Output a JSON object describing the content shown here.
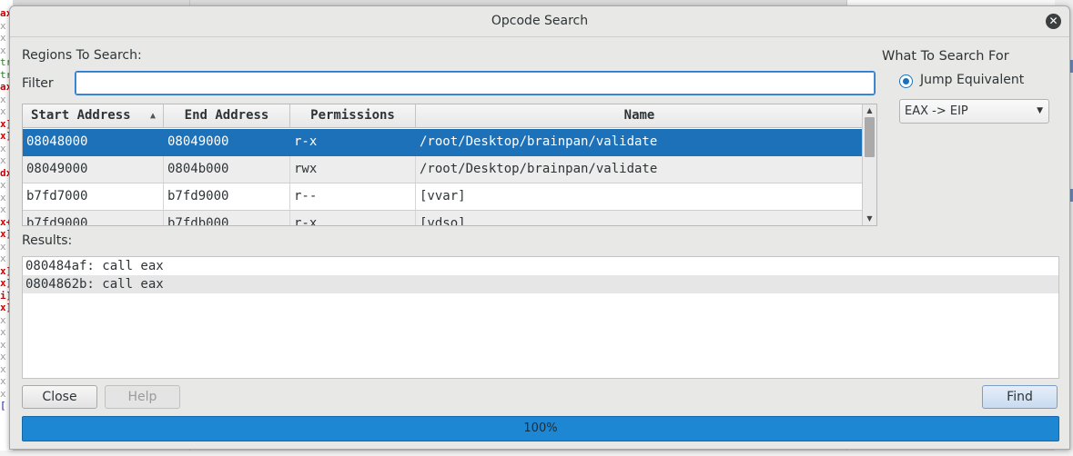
{
  "dialog": {
    "title": "Opcode Search",
    "regions_label": "Regions To Search:",
    "filter_label": "Filter",
    "filter_value": "",
    "what_to_search_label": "What To Search For",
    "search_type": "Jump Equivalent",
    "combo_value": "EAX -> EIP",
    "results_label": "Results:",
    "close_button": "Close",
    "help_button": "Help",
    "find_button": "Find",
    "progress_text": "100%",
    "progress_value": 1.0
  },
  "regions": {
    "columns": [
      "Start Address",
      "End Address",
      "Permissions",
      "Name"
    ],
    "rows": [
      {
        "start": "08048000",
        "end": "08049000",
        "perm": "r-x",
        "name": "/root/Desktop/brainpan/validate"
      },
      {
        "start": "08049000",
        "end": "0804b000",
        "perm": "rwx",
        "name": "/root/Desktop/brainpan/validate"
      },
      {
        "start": "b7fd7000",
        "end": "b7fd9000",
        "perm": "r--",
        "name": "[vvar]"
      },
      {
        "start": "b7fd9000",
        "end": "b7fdb000",
        "perm": "r-x",
        "name": "[vdso]"
      }
    ]
  },
  "results": [
    "080484af: call eax",
    "0804862b: call eax"
  ],
  "colors": {
    "accent": "#1d71b8",
    "progress": "#1d87d4"
  }
}
